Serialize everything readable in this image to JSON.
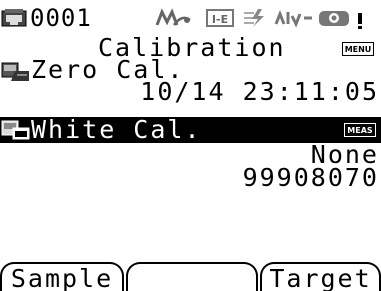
{
  "status": {
    "target_number": "0001",
    "icons": [
      "device-icon",
      "auto-average-icon",
      "ie-icon",
      "lightning-icon",
      "rgb-icon",
      "sensor-icon"
    ]
  },
  "screen": {
    "title": "Calibration",
    "menu_tag": "MENU",
    "meas_tag": "MEAS"
  },
  "items": [
    {
      "label": "Zero Cal.",
      "value": "10/14 23:11:05",
      "selected": false
    },
    {
      "label": "White Cal.",
      "values": [
        "None",
        "99908070"
      ],
      "selected": true
    }
  ],
  "softkeys": {
    "left": "Sample",
    "center": "",
    "right": "Target"
  },
  "colors": {
    "background": "#ffffff",
    "foreground": "#000000",
    "highlight": "#000000",
    "icon_gray": "#888888"
  }
}
